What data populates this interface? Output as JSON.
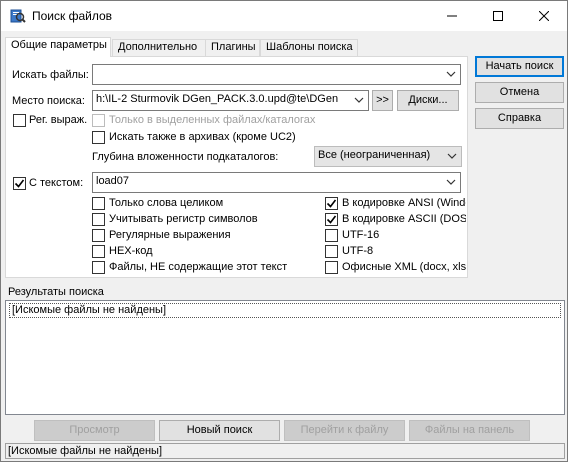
{
  "window": {
    "title": "Поиск файлов"
  },
  "tabs": [
    {
      "label": "Общие параметры"
    },
    {
      "label": "Дополнительно"
    },
    {
      "label": "Плагины"
    },
    {
      "label": "Шаблоны поиска"
    }
  ],
  "general": {
    "search_files_label": "Искать файлы:",
    "search_files_value": "",
    "location_label": "Место поиска:",
    "location_value": "h:\\IL-2 Sturmovik DGen_PACK.3.0.upd@te\\DGen",
    "browse_button": ">>",
    "drives_button": "Диски...",
    "regex_label": "Рег. выраж.",
    "only_selected_label": "Только в выделенных файлах/каталогах",
    "search_archives_label": "Искать также в архивах (кроме UC2)",
    "depth_label": "Глубина вложенности подкаталогов:",
    "depth_value": "Все (неограниченная)",
    "with_text_label": "С текстом:",
    "with_text_value": "load07"
  },
  "text_options_left": [
    {
      "label": "Только слова целиком",
      "checked": false
    },
    {
      "label": "Учитывать регистр символов",
      "checked": false
    },
    {
      "label": "Регулярные выражения",
      "checked": false
    },
    {
      "label": "HEX-код",
      "checked": false
    },
    {
      "label": "Файлы, НЕ содержащие этот текст",
      "checked": false
    }
  ],
  "text_options_right": [
    {
      "label": "В кодировке ANSI (Windo",
      "checked": true
    },
    {
      "label": "В кодировке ASCII (DOS)",
      "checked": true
    },
    {
      "label": "UTF-16",
      "checked": false
    },
    {
      "label": "UTF-8",
      "checked": false
    },
    {
      "label": "Офисные XML (docx, xlsx",
      "checked": false
    }
  ],
  "side_buttons": {
    "start": "Начать поиск",
    "cancel": "Отмена",
    "help": "Справка"
  },
  "results": {
    "label": "Результаты поиска",
    "items": [
      "[Искомые файлы не найдены]"
    ]
  },
  "bottom_buttons": {
    "view": "Просмотр",
    "new_search": "Новый поиск",
    "goto_file": "Перейти к файлу",
    "to_panel": "Файлы на панель"
  },
  "status": {
    "text": "[Искомые файлы не найдены]"
  },
  "colors": {
    "accent": "#0078d7",
    "check": "#000000"
  }
}
